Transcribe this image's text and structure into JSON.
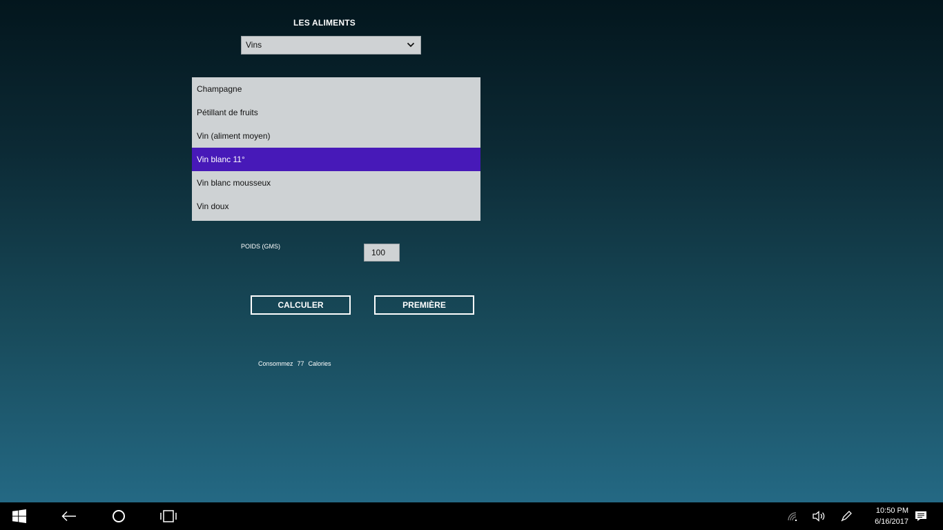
{
  "app": {
    "title": "LES ALIMENTS",
    "category_select": {
      "selected": "Vins",
      "icon": "chevron-down-icon"
    },
    "food_list": {
      "items": [
        "Champagne",
        "Pétillant de fruits",
        "Vin (aliment moyen)",
        "Vin blanc 11°",
        "Vin blanc mousseux",
        "Vin doux"
      ],
      "selected": "Vin blanc 11°",
      "selected_color": "#4719b8"
    },
    "weight": {
      "label": "POIDS (GMS)",
      "value": "100"
    },
    "buttons": {
      "calculate": "CALCULER",
      "first": "PREMIÈRE"
    },
    "result": {
      "prefix": "Consommez",
      "value": "77",
      "suffix": "Calories"
    }
  },
  "taskbar": {
    "start_icon": "windows-logo-icon",
    "back_icon": "back-arrow-icon",
    "cortana_icon": "cortana-circle-icon",
    "task_view_icon": "task-view-icon",
    "tray": {
      "network_icon": "network-icon",
      "volume_icon": "volume-icon",
      "pen_icon": "pen-icon",
      "notifications_icon": "action-center-icon"
    },
    "time": "10:50 PM",
    "date": "6/16/2017"
  }
}
